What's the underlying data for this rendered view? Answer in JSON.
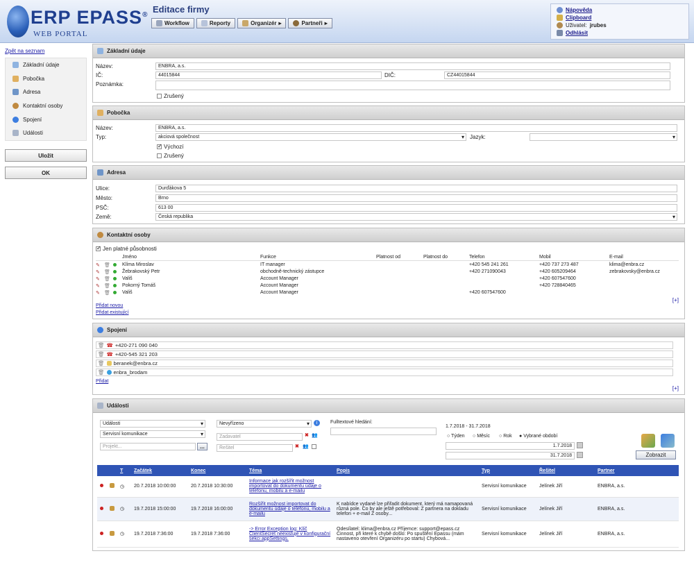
{
  "header": {
    "logo": "ERP EPASS",
    "logo_reg": "®",
    "logo_sub": "WEB PORTAL",
    "page_title": "Editace firmy",
    "menu": [
      {
        "label": "Workflow",
        "arrow": ""
      },
      {
        "label": "Reporty",
        "arrow": ""
      },
      {
        "label": "Organizér",
        "arrow": "▸"
      },
      {
        "label": "Partneři",
        "arrow": "▸"
      }
    ],
    "user": {
      "help": "Nápověda",
      "clipboard": "Clipboard",
      "user_label": "Uživatel:",
      "user_name": "jrubes",
      "logout": "Odhlásit"
    }
  },
  "sidebar": {
    "back": "Zpět na seznam",
    "items": [
      "Základní údaje",
      "Pobočka",
      "Adresa",
      "Kontaktní osoby",
      "Spojení",
      "Události"
    ],
    "save": "Uložit",
    "ok": "OK"
  },
  "basic": {
    "title": "Základní údaje",
    "name_label": "Název:",
    "name": "ENBRA, a.s.",
    "ic_label": "IČ:",
    "ic": "44015844",
    "dic_label": "DIČ:",
    "dic": "CZ44015844",
    "note_label": "Poznámka:",
    "cancelled": "Zrušený"
  },
  "branch": {
    "title": "Pobočka",
    "name_label": "Název:",
    "name": "ENBRA, a.s.",
    "type_label": "Typ:",
    "type": "akciová společnost",
    "lang_label": "Jazyk:",
    "lang": "",
    "default": "Výchozí",
    "cancelled": "Zrušený"
  },
  "address": {
    "title": "Adresa",
    "street_label": "Ulice:",
    "street": "Durďákova 5",
    "city_label": "Město:",
    "city": "Brno",
    "zip_label": "PSČ:",
    "zip": "613 00",
    "country_label": "Země:",
    "country": "Česká republika"
  },
  "contacts": {
    "title": "Kontaktní osoby",
    "only_valid": "Jen platné působnosti",
    "cols": [
      "Jméno",
      "Funkce",
      "Platnost od",
      "Platnost do",
      "Telefon",
      "Mobil",
      "E-mail"
    ],
    "rows": [
      {
        "name": "Klíma Miroslav",
        "role": "IT manager",
        "from": "",
        "to": "",
        "phone": "+420 545 241 261",
        "mobile": "+420 737 273 487",
        "email": "klima@enbra.cz"
      },
      {
        "name": "Žebrakovský Petr",
        "role": "obchodně-technický zástupce",
        "from": "",
        "to": "",
        "phone": "+420 271090043",
        "mobile": "+420 605209464",
        "email": "zebrakovsky@enbra.cz"
      },
      {
        "name": "Vališ",
        "role": "Account Manager",
        "from": "",
        "to": "",
        "phone": "",
        "mobile": "+420 607547600",
        "email": ""
      },
      {
        "name": "Pokorný Tomáš",
        "role": "Account Manager",
        "from": "",
        "to": "",
        "phone": "",
        "mobile": "+420 728840465",
        "email": ""
      },
      {
        "name": "Vališ",
        "role": "Account Manager",
        "from": "",
        "to": "",
        "phone": "+420 607547600",
        "mobile": "",
        "email": ""
      }
    ],
    "add_new": "Přidat novou",
    "add_existing": "Přidat existující",
    "more": "[+]"
  },
  "connections": {
    "title": "Spojení",
    "rows": [
      {
        "value": "+420-271 090 040",
        "icon": "phone-icon"
      },
      {
        "value": "+420-545 321 203",
        "icon": "phone-icon"
      },
      {
        "value": "beranek@enbra.cz",
        "icon": "envelope-icon"
      },
      {
        "value": "enbra_brodam",
        "icon": "skype-icon"
      }
    ],
    "add": "Přidat",
    "more": "[+]"
  },
  "events": {
    "title": "Události",
    "filter_type": "Události",
    "filter_status": "Nevyřízeno",
    "filter_category": "Servisní komunikace",
    "project_ph": "Projekt...",
    "assigner_ph": "Zadavatel",
    "solver_ph": "Řešitel",
    "ellipsis": "...",
    "fulltext_label": "Fulltextové hledání:",
    "period": "1.7.2018 - 31.7.2018",
    "radio": [
      "Týden",
      "Měsíc",
      "Rok",
      "Vybrané období"
    ],
    "date_from": "1.7.2018",
    "date_to": "31.7.2018",
    "show": "Zobrazit",
    "cols": [
      "T",
      "Začátek",
      "Konec",
      "Téma",
      "Popis",
      "Typ",
      "Řešitel",
      "Partner"
    ],
    "rows": [
      {
        "start": "20.7.2018 10:00:00",
        "end": "20.7.2018 10:30:00",
        "topic": "Informace jak rozšířit možnost importovat do dokumentu údaje o telefonu, mobilu a e-mailu",
        "desc": "",
        "type": "Servisní komunikace",
        "solver": "Jelínek Jiří",
        "partner": "ENBRA, a.s."
      },
      {
        "start": "19.7.2018 15:00:00",
        "end": "19.7.2018 16:00:00",
        "topic": "Rozšířit možnost importovat do dokumentu údaje o telefonu, mobilu a e-mailu",
        "desc": "K nabídce vydané lze přiřadit dokument, který má namapovaná různá pole. Co by ale ještě potřeboval: Z partnera na dokladu telefon + e-mail Z osoby...",
        "type": "Servisní komunikace",
        "solver": "Jelínek Jiří",
        "partner": "ENBRA, a.s."
      },
      {
        "start": "19.7.2018 7:36:00",
        "end": "19.7.2018 7:36:00",
        "topic": "-> Error Exception log: Klíč ClientSecret neexistuje v konfigurační sekci appSettings.",
        "desc": "Odesílatel: klima@enbra.cz Příjemce: support@epass.cz Činnost, při které k chybě došlo: Po spuštění Epassu (mám nastaveno otevření Organizéru po startu) Chybová...",
        "type": "Servisní komunikace",
        "solver": "Jelínek Jiří",
        "partner": "ENBRA, a.s."
      }
    ]
  },
  "colors": {
    "accent": "#2f54b5",
    "brand": "#1f3f8f"
  }
}
